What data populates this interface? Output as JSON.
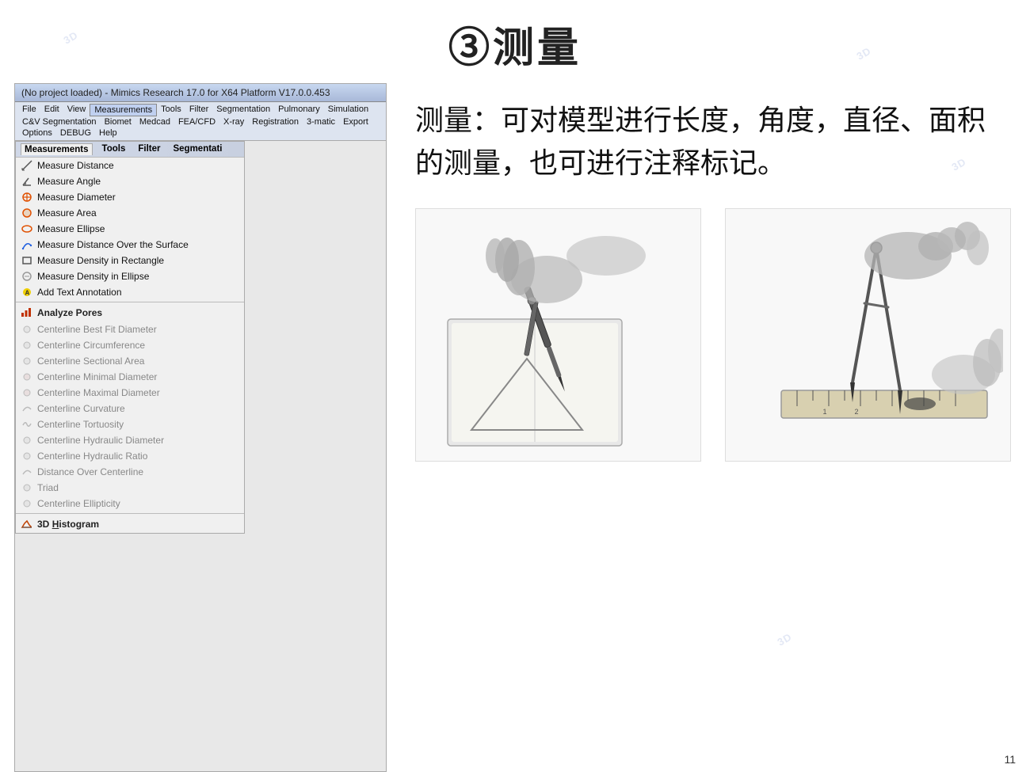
{
  "title": "③测量",
  "titlebar": "(No project loaded) - Mimics Research 17.0 for X64 Platform V17.0.0.453",
  "menubar": {
    "items": [
      "File",
      "Edit",
      "View",
      "Measurements",
      "Tools",
      "Filter",
      "Segmentation",
      "Pulmonary",
      "Simulation",
      "C&V Segmentation",
      "Biomet",
      "Medcad",
      "FEA/CFD",
      "X-ray",
      "Registration",
      "3-matic",
      "Export",
      "Options",
      "DEBUG",
      "Help"
    ]
  },
  "measurements_panel": {
    "tabs": [
      "Measurements",
      "Tools",
      "Filter",
      "Segmentati"
    ],
    "items": [
      {
        "icon": "ruler-diagonal",
        "label": "Measure Distance",
        "underline": "D",
        "disabled": false
      },
      {
        "icon": "angle",
        "label": "Measure Angle",
        "underline": "A",
        "disabled": false
      },
      {
        "icon": "circle-cross",
        "label": "Measure Diameter",
        "underline": "",
        "disabled": false
      },
      {
        "icon": "circle-area",
        "label": "Measure Area",
        "underline": "",
        "disabled": false
      },
      {
        "icon": "ellipse",
        "label": "Measure Ellipse",
        "underline": "",
        "disabled": false
      },
      {
        "icon": "ruler-surface",
        "label": "Measure Distance Over the Surface",
        "underline": "O",
        "disabled": false
      },
      {
        "icon": "rectangle",
        "label": "Measure Density in Rectangle",
        "underline": "R",
        "disabled": false
      },
      {
        "icon": "circle-density",
        "label": "Measure Density in Ellipse",
        "underline": "E",
        "disabled": false
      },
      {
        "icon": "text-annotation",
        "label": "Add Text Annotation",
        "underline": "",
        "disabled": false
      }
    ],
    "section2": {
      "header": {
        "icon": "chart",
        "label": "Analyze Pores"
      },
      "items": [
        {
          "label": "Centerline Best Fit Diameter",
          "disabled": true
        },
        {
          "label": "Centerline Circumference",
          "disabled": true
        },
        {
          "label": "Centerline Sectional Area",
          "disabled": true
        },
        {
          "label": "Centerline Minimal Diameter",
          "disabled": true
        },
        {
          "label": "Centerline Maximal Diameter",
          "disabled": true
        },
        {
          "label": "Centerline Curvature",
          "disabled": true
        },
        {
          "label": "Centerline Tortuosity",
          "disabled": true
        },
        {
          "label": "Centerline Hydraulic Diameter",
          "disabled": true
        },
        {
          "label": "Centerline Hydraulic Ratio",
          "disabled": true
        },
        {
          "label": "Distance Over Centerline",
          "disabled": true
        },
        {
          "label": "Triad",
          "disabled": true
        },
        {
          "label": "Centerline Ellipticity",
          "disabled": true
        }
      ]
    },
    "section3": {
      "header": {
        "icon": "histogram",
        "label": "3D Histogram",
        "underline": "H"
      }
    }
  },
  "description": "测量：可对模型进行长度，角度，直径、面积的测量，也可进行注释标记。",
  "page_number": "11"
}
